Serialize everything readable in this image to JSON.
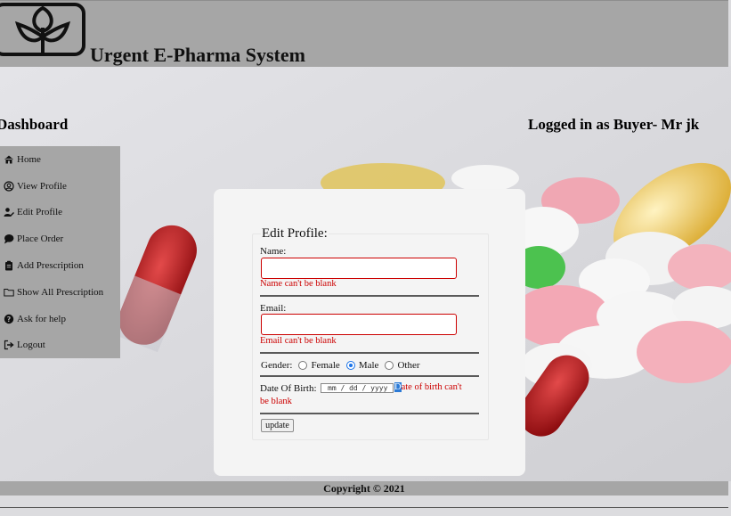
{
  "header": {
    "site_title": "Urgent E-Pharma System",
    "logo_icon": "caduceus-leaf-icon"
  },
  "dashboard": {
    "title": "Dashboard",
    "logged_in": "Logged in as Buyer- Mr jk"
  },
  "sidebar": {
    "items": [
      {
        "label": "Home",
        "icon": "home-icon"
      },
      {
        "label": "View Profile",
        "icon": "user-circle-icon"
      },
      {
        "label": "Edit Profile",
        "icon": "user-edit-icon"
      },
      {
        "label": "Place Order",
        "icon": "chat-bubble-icon"
      },
      {
        "label": "Add Prescription",
        "icon": "clipboard-icon"
      },
      {
        "label": "Show All Prescription",
        "icon": "folder-icon"
      },
      {
        "label": "Ask for help",
        "icon": "question-circle-icon"
      },
      {
        "label": "Logout",
        "icon": "logout-icon"
      }
    ]
  },
  "form": {
    "legend": "Edit Profile:",
    "name_label": "Name:",
    "name_value": "",
    "name_error": "Name can't be blank",
    "email_label": "Email:",
    "email_value": "",
    "email_error": "Email can't be blank",
    "gender_label": "Gender:",
    "gender_options": [
      "Female",
      "Male",
      "Other"
    ],
    "gender_selected": "Male",
    "dob_label": "Date Of Birth:",
    "dob_placeholder": "mm / dd / yyyy",
    "dob_error_cursor": "D",
    "dob_error_rest": "ate of birth can't",
    "dob_error_line2": "be blank",
    "update_label": "update"
  },
  "footer": {
    "copyright": "Copyright © 2021"
  },
  "colors": {
    "header_bg": "#a6a6a6",
    "error": "#cc0000",
    "card_bg": "#f4f4f4"
  }
}
